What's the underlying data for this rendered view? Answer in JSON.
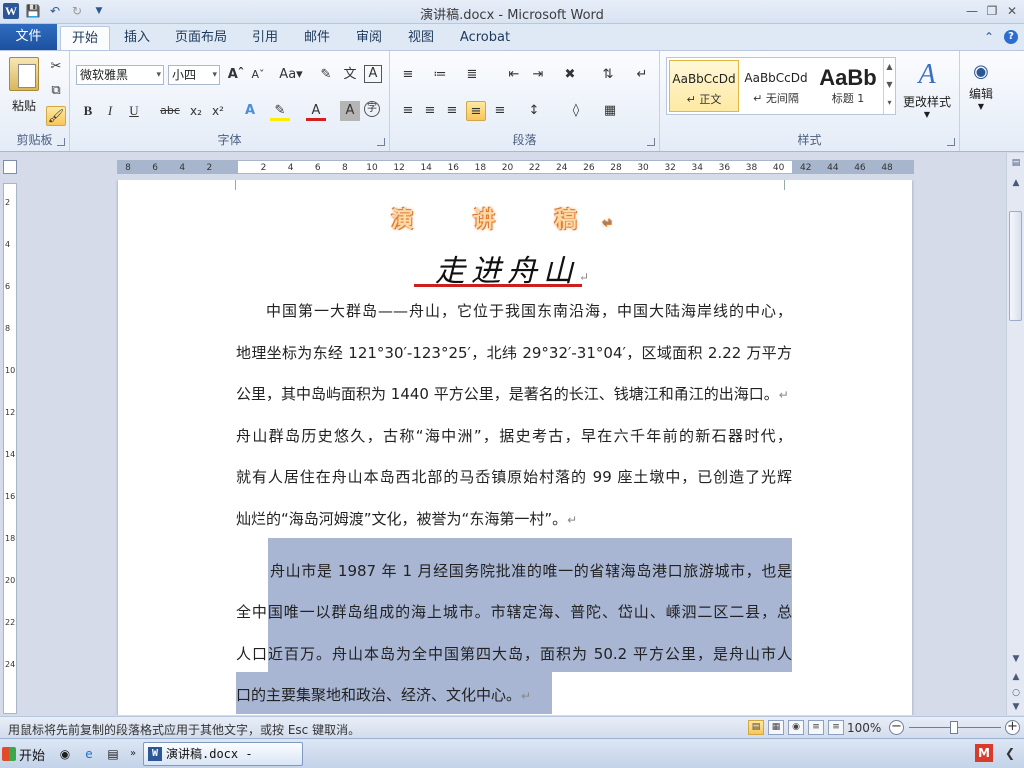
{
  "app": {
    "window_title": "演讲稿.docx - Microsoft Word",
    "word_logo": "W"
  },
  "quick_access": {
    "save_icon": "save-icon",
    "undo_icon": "undo-icon",
    "redo_icon": "redo-icon"
  },
  "ribbon_tabs": [
    "文件",
    "开始",
    "插入",
    "页面布局",
    "引用",
    "邮件",
    "审阅",
    "视图",
    "Acrobat"
  ],
  "active_tab": "开始",
  "clipboard": {
    "paste_label": "粘贴",
    "group_label": "剪贴板"
  },
  "font": {
    "font_name": "微软雅黑",
    "font_size": "小四",
    "group_label": "字体"
  },
  "paragraph": {
    "group_label": "段落"
  },
  "styles": {
    "items": [
      {
        "sample": "AaBbCcDd",
        "name": "↵ 正文"
      },
      {
        "sample": "AaBbCcDd",
        "name": "↵ 无间隔"
      },
      {
        "sample": "AaBb",
        "name": "标题 1"
      }
    ],
    "change_styles_label": "更改样式",
    "group_label": "样式"
  },
  "editing": {
    "label": "编辑"
  },
  "ruler": {
    "ticks": [
      "8",
      "6",
      "4",
      "2",
      "",
      "2",
      "4",
      "6",
      "8",
      "10",
      "12",
      "14",
      "16",
      "18",
      "20",
      "22",
      "24",
      "26",
      "28",
      "30",
      "32",
      "34",
      "36",
      "38",
      "40",
      "42",
      "44",
      "46",
      "48"
    ]
  },
  "vruler": {
    "ticks": [
      "2",
      "4",
      "6",
      "8",
      "10",
      "12",
      "14",
      "16",
      "18",
      "20",
      "22",
      "24"
    ]
  },
  "document": {
    "title1": "演 讲 稿",
    "title2": "走进舟山",
    "paragraphs": [
      {
        "lines": [
          "中国第一大群岛——舟山，它位于我国东南沿海，中国大陆海岸线的中心，",
          "地理坐标为东经 121°30′-123°25′，北纬 29°32′-31°04′，区域面积 2.22 万平方",
          "公里，其中岛屿面积为 1440 平方公里，是著名的长江、钱塘江和甬江的出海口。"
        ]
      },
      {
        "lines": [
          "舟山群岛历史悠久，古称“海中洲”，据史考古，早在六千年前的新石器时代，",
          "就有人居住在舟山本岛西北部的马岙镇原始村落的 99 座土墩中，已创造了光辉",
          "灿烂的“海岛河姆渡”文化，被誉为“东海第一村”。"
        ]
      },
      {
        "lines": [
          "舟山市是 1987 年 1 月经国务院批准的唯一的省辖海岛港口旅游城市，也是",
          "全中国唯一以群岛组成的海上城市。市辖定海、普陀、岱山、嵊泗二区二县，总",
          "人口近百万。舟山本岛为全中国第四大岛，面积为 50.2 平方公里，是舟山市人",
          "口的主要集聚地和政治、经济、文化中心。"
        ]
      }
    ]
  },
  "statusbar": {
    "message": "用鼠标将先前复制的段落格式应用于其他文字，或按 Esc 键取消。",
    "zoom": "100%"
  },
  "taskbar": {
    "start_label": "开始",
    "task_label": "演讲稿.docx - Micro..."
  },
  "colors": {
    "selection": "#a8b6d4",
    "title_underline": "#cc1f1f",
    "file_tab": "#2b5797"
  }
}
